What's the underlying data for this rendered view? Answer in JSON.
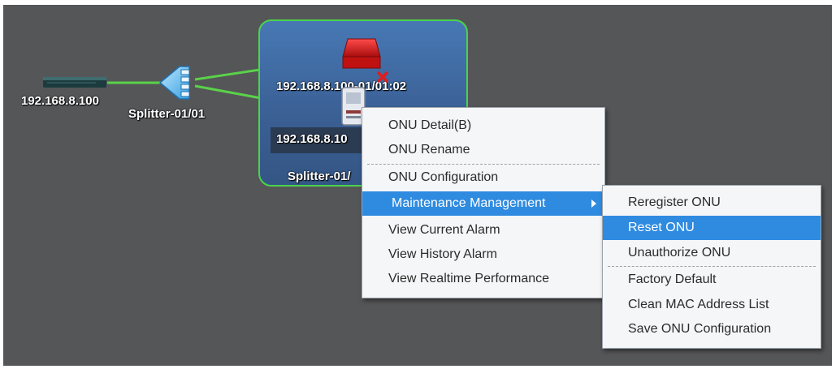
{
  "topology": {
    "olt_label": "192.168.8.100",
    "splitter_label": "Splitter-01/01",
    "onu1_label": "192.168.8.100-01/01:02",
    "onu2_label": "192.168.8.10",
    "group_label": "Splitter-01/"
  },
  "context_menu": {
    "items": [
      {
        "label": "ONU Detail(B)"
      },
      {
        "label": "ONU Rename"
      },
      {
        "label": "ONU Configuration"
      },
      {
        "label": "Maintenance Management"
      },
      {
        "label": "View Current Alarm"
      },
      {
        "label": "View History Alarm"
      },
      {
        "label": "View Realtime Performance"
      }
    ]
  },
  "submenu": {
    "items": [
      {
        "label": "Reregister ONU"
      },
      {
        "label": "Reset ONU"
      },
      {
        "label": "Unauthorize ONU"
      },
      {
        "label": "Factory Default"
      },
      {
        "label": "Clean MAC Address List"
      },
      {
        "label": "Save ONU Configuration"
      }
    ]
  },
  "colors": {
    "canvas": "#555658",
    "link": "#5ad24a",
    "group_border": "#4bd34b",
    "highlight": "#2f8be0",
    "onu_alarm": "#d61818"
  },
  "icons": [
    "olt-device-icon",
    "splitter-icon",
    "onu-alarm-icon",
    "onu-device-icon",
    "error-x-icon",
    "submenu-arrow-icon"
  ]
}
